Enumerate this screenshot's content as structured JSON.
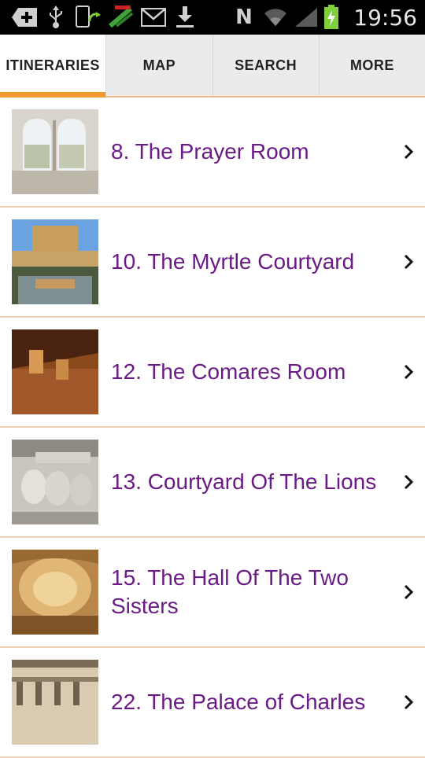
{
  "status_bar": {
    "time": "19:56",
    "icons": [
      "add-icon",
      "usb-icon",
      "phone-sync-icon",
      "no-signal-app-icon",
      "gmail-icon",
      "download-icon",
      "nfc-icon",
      "wifi-icon",
      "signal-icon",
      "battery-charging-icon"
    ],
    "nfc_letter": "N"
  },
  "tabs": [
    {
      "label": "ITINERARIES",
      "active": true
    },
    {
      "label": "MAP",
      "active": false
    },
    {
      "label": "SEARCH",
      "active": false
    },
    {
      "label": "MORE",
      "active": false
    }
  ],
  "items": [
    {
      "title": "8. The Prayer Room",
      "thumb": "prayer-room-photo"
    },
    {
      "title": "10. The Myrtle Courtyard",
      "thumb": "myrtle-courtyard-photo"
    },
    {
      "title": "12. The Comares Room",
      "thumb": "comares-room-photo"
    },
    {
      "title": "13. Courtyard Of The Lions",
      "thumb": "lions-courtyard-photo"
    },
    {
      "title": "15. The Hall Of The Two Sisters",
      "thumb": "two-sisters-hall-photo"
    },
    {
      "title": "22. The Palace of Charles",
      "thumb": "palace-charles-photo"
    }
  ],
  "colors": {
    "accent": "#f29a2e",
    "title_text": "#6b1b86",
    "divider": "#f4cfb4",
    "tab_bg": "#ebebeb"
  }
}
